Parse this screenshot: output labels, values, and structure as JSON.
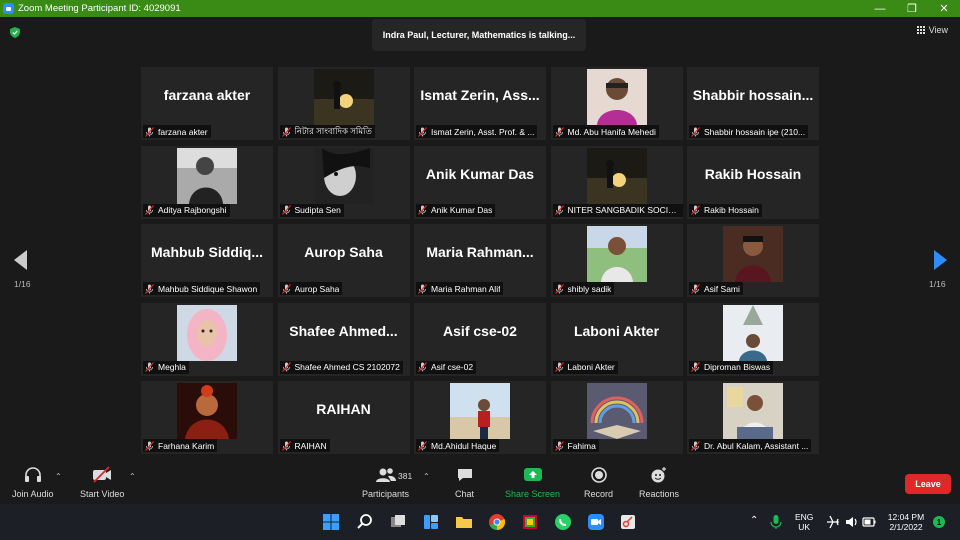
{
  "window": {
    "title": "Zoom Meeting Participant ID: 4029091"
  },
  "banner": {
    "talking": "Indra Paul, Lecturer, Mathematics is talking..."
  },
  "view": {
    "label": "View"
  },
  "pagination": {
    "left": "1/16",
    "right": "1/16"
  },
  "tiles": [
    {
      "big": "farzana akter",
      "label": "farzana akter"
    },
    {
      "avatar": "sunset-silhouette",
      "label": "নিটার সাংবাদিক সমিতি"
    },
    {
      "big": "Ismat  Zerin,  Ass...",
      "label": "Ismat Zerin, Asst. Prof. & ..."
    },
    {
      "avatar": "man-portrait",
      "label": "Md. Abu Hanifa Mehedi"
    },
    {
      "big": "Shabbir  hossain...",
      "label": "Shabbir hossain ipe (210..."
    },
    {
      "avatar": "man-bw",
      "label": "Aditya Rajbongshi"
    },
    {
      "avatar": "woman-bw",
      "label": "Sudipta Sen"
    },
    {
      "big": "Anik Kumar Das",
      "label": "Anik Kumar Das"
    },
    {
      "avatar": "sunset-silhouette",
      "label": "NITER SANGBADIK SOCIETY"
    },
    {
      "big": "Rakib Hossain",
      "label": "Rakib Hossain"
    },
    {
      "big": "Mahbub  Siddiq...",
      "label": "Mahbub Siddique Shawon"
    },
    {
      "big": "Aurop Saha",
      "label": "Aurop Saha"
    },
    {
      "big": "Maria  Rahman...",
      "label": "Maria Rahman Alif"
    },
    {
      "avatar": "man-outdoor",
      "label": "shibly sadik"
    },
    {
      "avatar": "man-portrait-dark",
      "label": "Asif Sami"
    },
    {
      "avatar": "woman-hijab",
      "label": "Meghla"
    },
    {
      "big": "Shafee  Ahmed...",
      "label": "Shafee Ahmed CS 2102072"
    },
    {
      "big": "Asif cse-02",
      "label": "Asif cse-02"
    },
    {
      "big": "Laboni Akter",
      "label": "Laboni Akter"
    },
    {
      "avatar": "man-outdoor-tree",
      "label": "Diproman Biswas"
    },
    {
      "avatar": "woman-dark",
      "label": "Farhana Karim"
    },
    {
      "big": "RAIHAN",
      "label": "RAIHAN"
    },
    {
      "avatar": "man-beach",
      "label": "Md.Ahidul Haque"
    },
    {
      "avatar": "rainbow-book",
      "label": "Fahima"
    },
    {
      "avatar": "man-office",
      "label": "Dr. Abul Kalam, Assistant ..."
    }
  ],
  "toolbar": {
    "join_audio": "Join Audio",
    "start_video": "Start Video",
    "participants": "Participants",
    "participant_count": "381",
    "chat": "Chat",
    "share_screen": "Share Screen",
    "record": "Record",
    "reactions": "Reactions",
    "leave": "Leave"
  },
  "taskbar": {
    "lang_top": "ENG",
    "lang_bottom": "UK",
    "time": "12:04 PM",
    "date": "2/1/2022",
    "notifications": "1"
  },
  "colors": {
    "titlebar": "#3a8a16",
    "share": "#1db954",
    "leave": "#e02828",
    "accent": "#2d8cff"
  }
}
